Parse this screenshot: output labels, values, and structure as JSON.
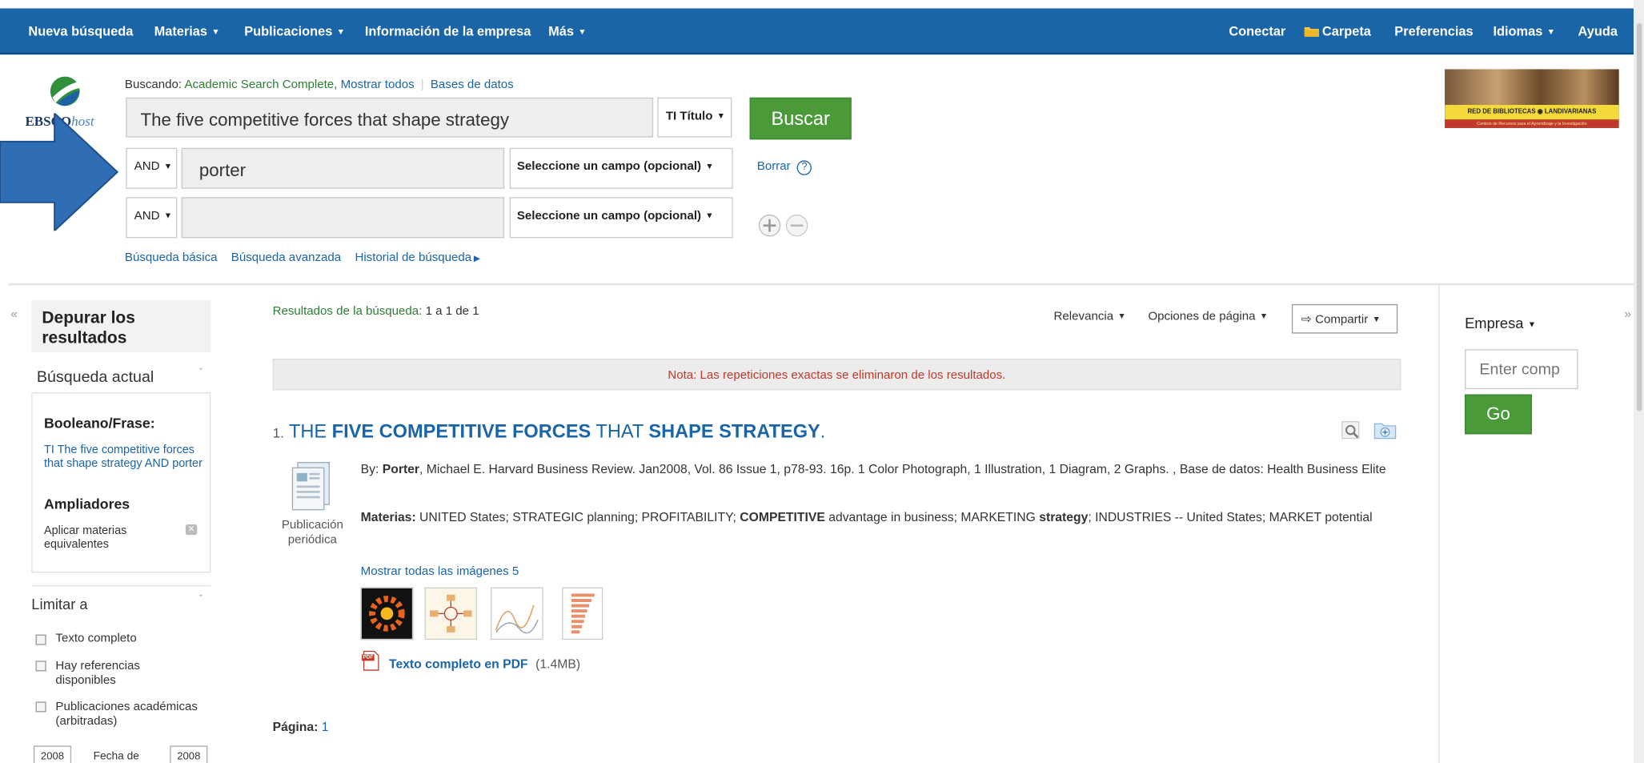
{
  "nav": {
    "items": [
      "Nueva búsqueda",
      "Materias",
      "Publicaciones",
      "Información de la empresa",
      "Más"
    ],
    "right": [
      "Conectar",
      "Carpeta",
      "Preferencias",
      "Idiomas",
      "Ayuda"
    ]
  },
  "logo": {
    "brand": "EBSCO",
    "suffix": "host"
  },
  "search": {
    "searching_label": "Buscando:",
    "database": "Academic Search Complete,",
    "show_all": "Mostrar todos",
    "databases_link": "Bases de datos",
    "rows": [
      {
        "operator": "",
        "value": "The five competitive forces that shape strategy",
        "field": "TI Título"
      },
      {
        "operator": "AND",
        "value": "porter",
        "field": "Seleccione un campo (opcional)"
      },
      {
        "operator": "AND",
        "value": "",
        "field": "Seleccione un campo (opcional)"
      }
    ],
    "search_button": "Buscar",
    "clear_link": "Borrar",
    "help_glyph": "?",
    "links": [
      "Búsqueda básica",
      "Búsqueda avanzada",
      "Historial de búsqueda"
    ]
  },
  "library_banner": {
    "title": "RED DE BIBLIOTECAS",
    "name": "LANDIVARIANAS",
    "subtitle": "Centros de Recursos para el Aprendizaje y la Investigación"
  },
  "sidebar": {
    "title": "Depurar los resultados",
    "current_search": "Búsqueda actual",
    "boolean_label": "Booleano/Frase:",
    "boolean_query": "TI The five competitive forces that shape strategy AND porter",
    "expanders": "Ampliadores",
    "apply_equivalent": "Aplicar materias equivalentes",
    "limit_to": "Limitar a",
    "limits": [
      "Texto completo",
      "Hay referencias disponibles",
      "Publicaciones académicas (arbitradas)"
    ],
    "date_from": "2008",
    "date_label": "Fecha de",
    "date_to": "2008"
  },
  "results": {
    "summary_label": "Resultados de la búsqueda:",
    "summary_value": "1 a 1 de 1",
    "sort": "Relevancia",
    "page_options": "Opciones de página",
    "share": "Compartir",
    "note": "Nota: Las repeticiones exactas se eliminaron de los resultados.",
    "item": {
      "number": "1.",
      "title_parts": [
        "THE ",
        "FIVE COMPETITIVE FORCES",
        " THAT ",
        "SHAPE STRATEGY",
        "."
      ],
      "type_label": "Publicación periódica",
      "by_label": "By:",
      "author_bold": "Porter",
      "byline_rest": ", Michael E. Harvard Business Review. Jan2008, Vol. 86 Issue 1, p78-93. 16p. 1 Color Photograph, 1 Illustration, 1 Diagram, 2 Graphs. , Base de datos: Health Business Elite",
      "subjects_label": "Materias:",
      "subjects_a": "UNITED States; STRATEGIC planning; PROFITABILITY; ",
      "subjects_b": "COMPETITIVE",
      "subjects_c": " advantage in business; MARKETING ",
      "subjects_d": "strategy",
      "subjects_e": "; INDUSTRIES -- United States; MARKET potential",
      "images_link": "Mostrar todas las imágenes 5",
      "pdf_icon_text": "PDF",
      "pdf_link": "Texto completo en PDF",
      "pdf_size": "(1.4MB)"
    },
    "page_label": "Página:",
    "page_number": "1"
  },
  "right_panel": {
    "company_label": "Empresa",
    "placeholder": "Enter comp",
    "go": "Go"
  },
  "colors": {
    "nav": "#1a64a8",
    "link": "#1a64a8",
    "button_green": "#4a9a3a",
    "arrow": "#2f6db5",
    "note_text": "#c0392b"
  }
}
